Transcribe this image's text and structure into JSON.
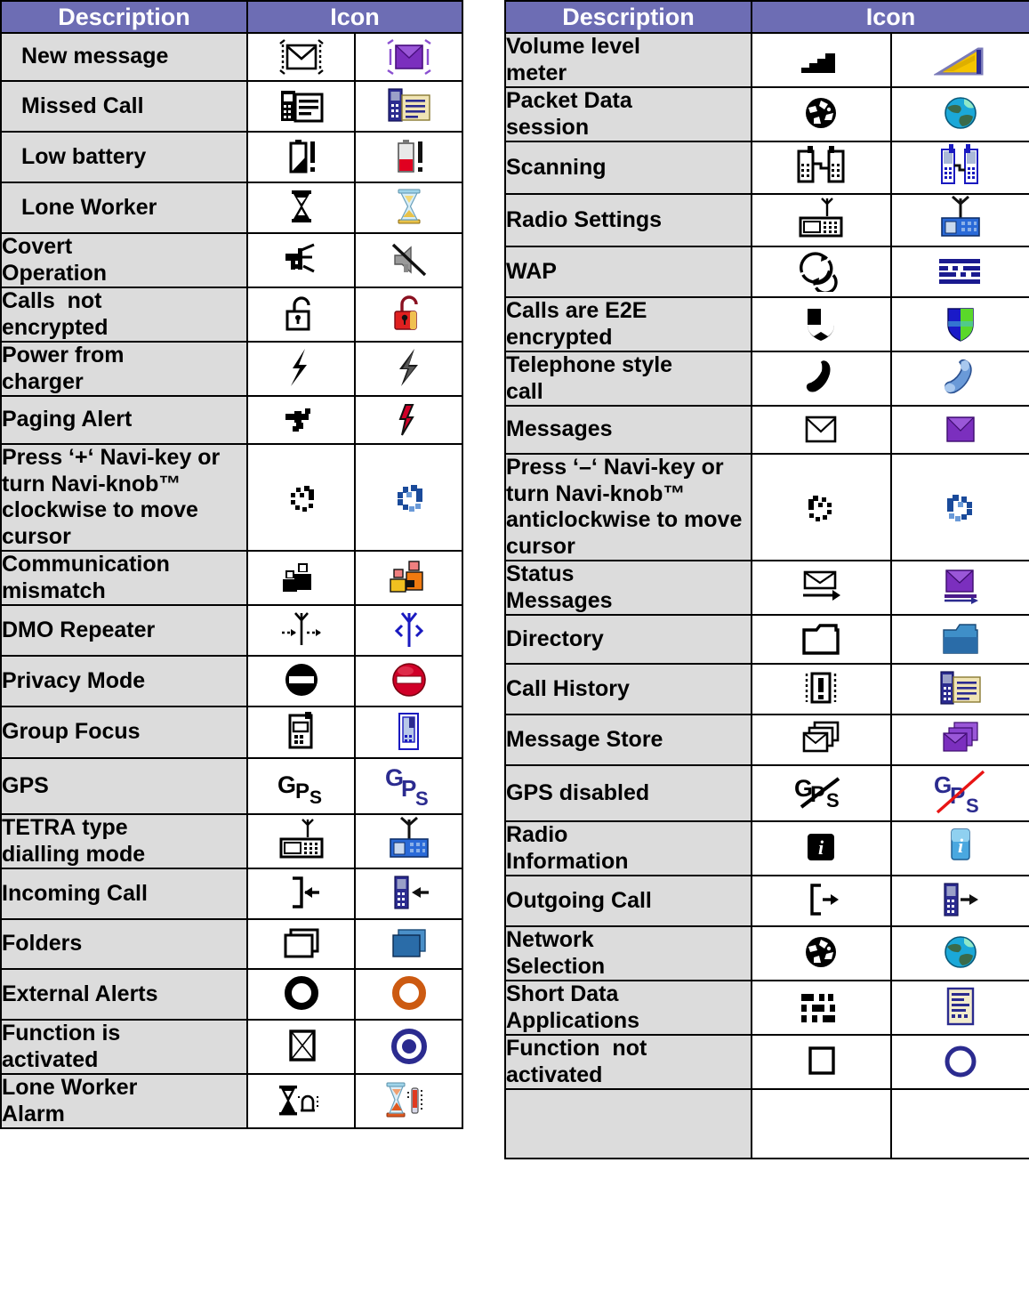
{
  "headers": {
    "description": "Description",
    "icon": "Icon"
  },
  "colors": {
    "header_bg": "#6d6db4",
    "header_text": "#ffffff",
    "desc_cell_bg": "#dcdcdc",
    "icon_cell_bg": "#ffffff",
    "border": "#000000",
    "accent_purple": "#7b2fbe",
    "accent_red": "#d4002a",
    "accent_blue": "#1a3fa0",
    "accent_orange": "#cc5a11",
    "accent_yellow": "#f5c400",
    "accent_navy": "#2b2b8f"
  },
  "left_table": {
    "rows": [
      {
        "description": "New message",
        "mono_icon": "envelope-flash-mono-icon",
        "color_icon": "envelope-flash-color-icon"
      },
      {
        "description": "Missed Call",
        "mono_icon": "phone-list-mono-icon",
        "color_icon": "phone-list-color-icon"
      },
      {
        "description": "Low battery",
        "mono_icon": "battery-low-mono-icon",
        "color_icon": "battery-low-color-icon"
      },
      {
        "description": "Lone Worker",
        "mono_icon": "hourglass-mono-icon",
        "color_icon": "hourglass-color-icon"
      },
      {
        "description": "Covert\nOperation",
        "mono_icon": "speaker-muted-mono-icon",
        "color_icon": "speaker-muted-color-icon"
      },
      {
        "description": "Calls  not\nencrypted",
        "mono_icon": "padlock-open-mono-icon",
        "color_icon": "padlock-open-color-icon"
      },
      {
        "description": "Power from\ncharger",
        "mono_icon": "lightning-bolt-mono-icon",
        "color_icon": "lightning-bolt-color-icon"
      },
      {
        "description": "Paging Alert",
        "mono_icon": "paging-alert-mono-icon",
        "color_icon": "paging-alert-color-icon"
      },
      {
        "description": "Press ‘+‘ Navi-key or turn Navi-knob™ clockwise to move cursor",
        "mono_icon": "rotate-clockwise-mono-icon",
        "color_icon": "rotate-clockwise-color-icon"
      },
      {
        "description": "Communication\nmismatch",
        "mono_icon": "two-people-mono-icon",
        "color_icon": "two-people-color-icon"
      },
      {
        "description": "DMO Repeater",
        "mono_icon": "dmo-repeater-mono-icon",
        "color_icon": "dmo-repeater-color-icon"
      },
      {
        "description": "Privacy Mode",
        "mono_icon": "no-entry-mono-icon",
        "color_icon": "no-entry-color-icon"
      },
      {
        "description": "Group Focus",
        "mono_icon": "handset-focus-mono-icon",
        "color_icon": "handset-focus-color-icon"
      },
      {
        "description": "GPS",
        "mono_icon": "gps-mono-icon",
        "color_icon": "gps-color-icon"
      },
      {
        "description": "TETRA type\ndialling mode",
        "mono_icon": "radio-antenna-mono-icon",
        "color_icon": "radio-antenna-color-icon"
      },
      {
        "description": "Incoming Call",
        "mono_icon": "incoming-call-mono-icon",
        "color_icon": "incoming-call-color-icon"
      },
      {
        "description": "Folders",
        "mono_icon": "folders-stack-mono-icon",
        "color_icon": "folders-stack-color-icon"
      },
      {
        "description": "External Alerts",
        "mono_icon": "ring-alert-mono-icon",
        "color_icon": "ring-alert-color-icon"
      },
      {
        "description": "Function is\nactivated",
        "mono_icon": "checkbox-crossed-mono-icon",
        "color_icon": "filled-target-color-icon"
      },
      {
        "description": "Lone Worker\nAlarm",
        "mono_icon": "hourglass-bell-mono-icon",
        "color_icon": "hourglass-bell-color-icon"
      }
    ]
  },
  "right_table": {
    "rows": [
      {
        "description": "Volume level\nmeter",
        "mono_icon": "volume-meter-mono-icon",
        "color_icon": "volume-meter-color-icon"
      },
      {
        "description": "Packet Data\nsession",
        "mono_icon": "globe-mono-icon",
        "color_icon": "globe-color-icon"
      },
      {
        "description": "Scanning",
        "mono_icon": "scanning-radios-mono-icon",
        "color_icon": "scanning-radios-color-icon"
      },
      {
        "description": "Radio Settings",
        "mono_icon": "radio-antenna-mono-icon",
        "color_icon": "radio-antenna-color-icon"
      },
      {
        "description": "WAP",
        "mono_icon": "wap-swirl-mono-icon",
        "color_icon": "wap-logo-color-icon"
      },
      {
        "description": "Calls are E2E\nencrypted",
        "mono_icon": "shield-mono-icon",
        "color_icon": "shield-color-icon"
      },
      {
        "description": "Telephone style\ncall",
        "mono_icon": "handset-mono-icon",
        "color_icon": "handset-color-icon"
      },
      {
        "description": "Messages",
        "mono_icon": "envelope-mono-icon",
        "color_icon": "envelope-color-icon"
      },
      {
        "description": "Press ‘–‘ Navi-key or turn Navi-knob™ anticlockwise to move cursor",
        "mono_icon": "rotate-anticlockwise-mono-icon",
        "color_icon": "rotate-anticlockwise-color-icon"
      },
      {
        "description": "Status\nMessages",
        "mono_icon": "status-message-mono-icon",
        "color_icon": "status-message-color-icon"
      },
      {
        "description": "Directory",
        "mono_icon": "folder-mono-icon",
        "color_icon": "folder-color-icon"
      },
      {
        "description": "Call History",
        "mono_icon": "call-history-mono-icon",
        "color_icon": "call-history-color-icon"
      },
      {
        "description": "Message Store",
        "mono_icon": "message-store-mono-icon",
        "color_icon": "message-store-color-icon"
      },
      {
        "description": "GPS disabled",
        "mono_icon": "gps-disabled-mono-icon",
        "color_icon": "gps-disabled-color-icon"
      },
      {
        "description": "Radio\nInformation",
        "mono_icon": "info-mono-icon",
        "color_icon": "info-color-icon"
      },
      {
        "description": "Outgoing Call",
        "mono_icon": "outgoing-call-mono-icon",
        "color_icon": "outgoing-call-color-icon"
      },
      {
        "description": "Network\nSelection",
        "mono_icon": "globe-mono-icon",
        "color_icon": "globe-color-icon"
      },
      {
        "description": "Short Data\nApplications",
        "mono_icon": "short-data-mono-icon",
        "color_icon": "short-data-color-icon"
      },
      {
        "description": "Function  not\nactivated",
        "mono_icon": "empty-box-mono-icon",
        "color_icon": "hollow-ring-color-icon"
      },
      {
        "description": "",
        "mono_icon": "",
        "color_icon": ""
      }
    ]
  }
}
